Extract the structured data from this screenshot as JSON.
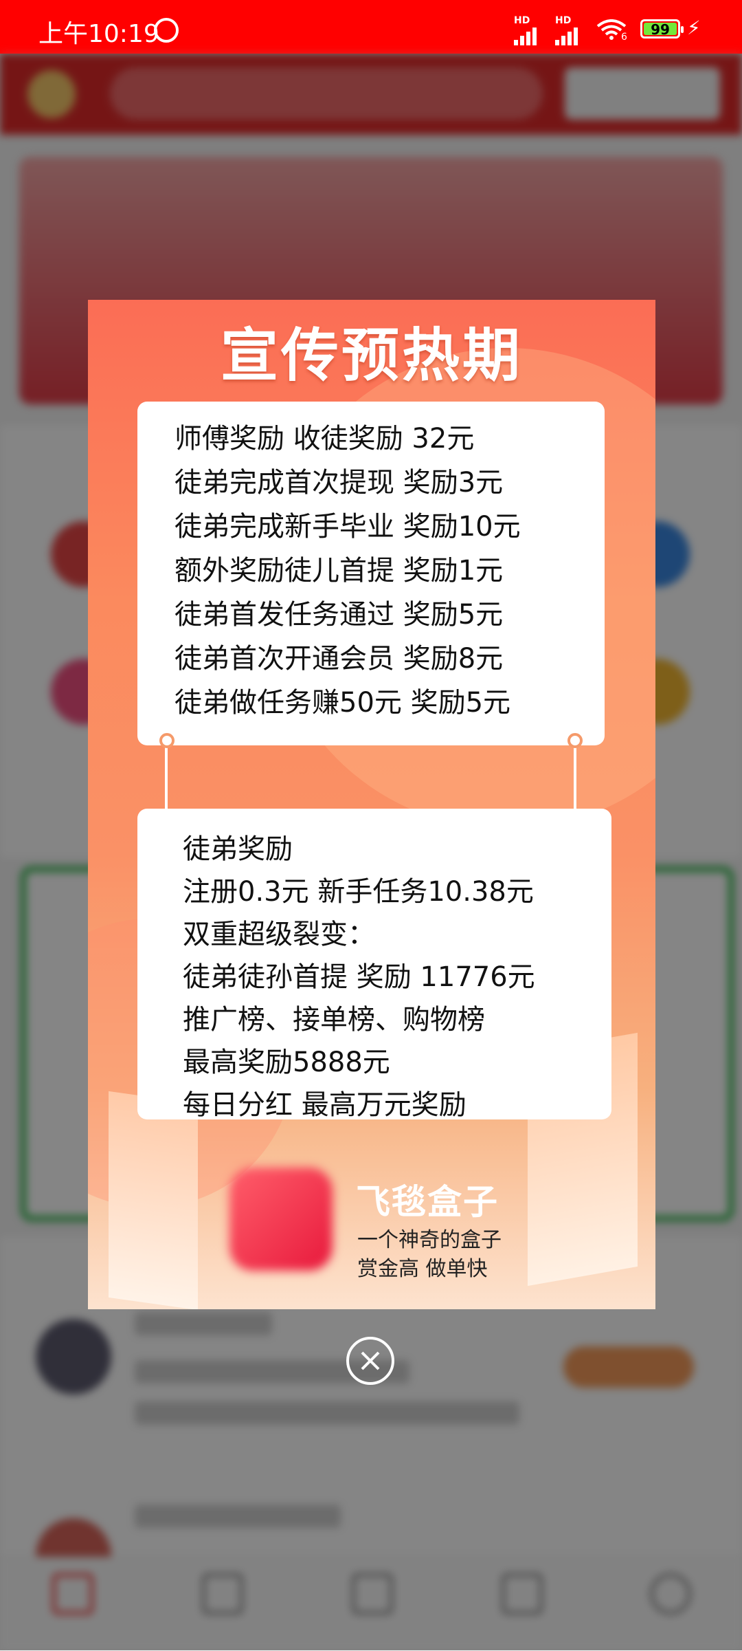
{
  "status_bar": {
    "time": "上午10:19",
    "battery": "99",
    "sim1_label": "HD",
    "sim2_label": "HD",
    "wifi_label": "6"
  },
  "popup": {
    "title": "宣传预热期",
    "master_rewards": [
      "师傅奖励 收徒奖励 32元",
      "徒弟完成首次提现 奖励3元",
      "徒弟完成新手毕业 奖励10元",
      "额外奖励徒儿首提 奖励1元",
      "徒弟首发任务通过 奖励5元",
      "徒弟首次开通会员 奖励8元",
      "徒弟做任务赚50元 奖励5元"
    ],
    "apprentice_rewards": [
      "徒弟奖励",
      "注册0.3元  新手任务10.38元",
      "双重超级裂变：",
      "徒弟徒孙首提 奖励 11776元",
      "推广榜、接单榜、购物榜",
      "最高奖励5888元",
      "每日分红 最高万元奖励"
    ],
    "brand": {
      "name": "飞毯盒子",
      "tagline": "一个神奇的盒子",
      "slogan": "赏金高 做单快"
    }
  },
  "colors": {
    "status_bar": "#ff0000",
    "popup_top": "#fb6d55",
    "popup_bottom": "#fde3cf",
    "dot_border": "#f59a6a"
  }
}
